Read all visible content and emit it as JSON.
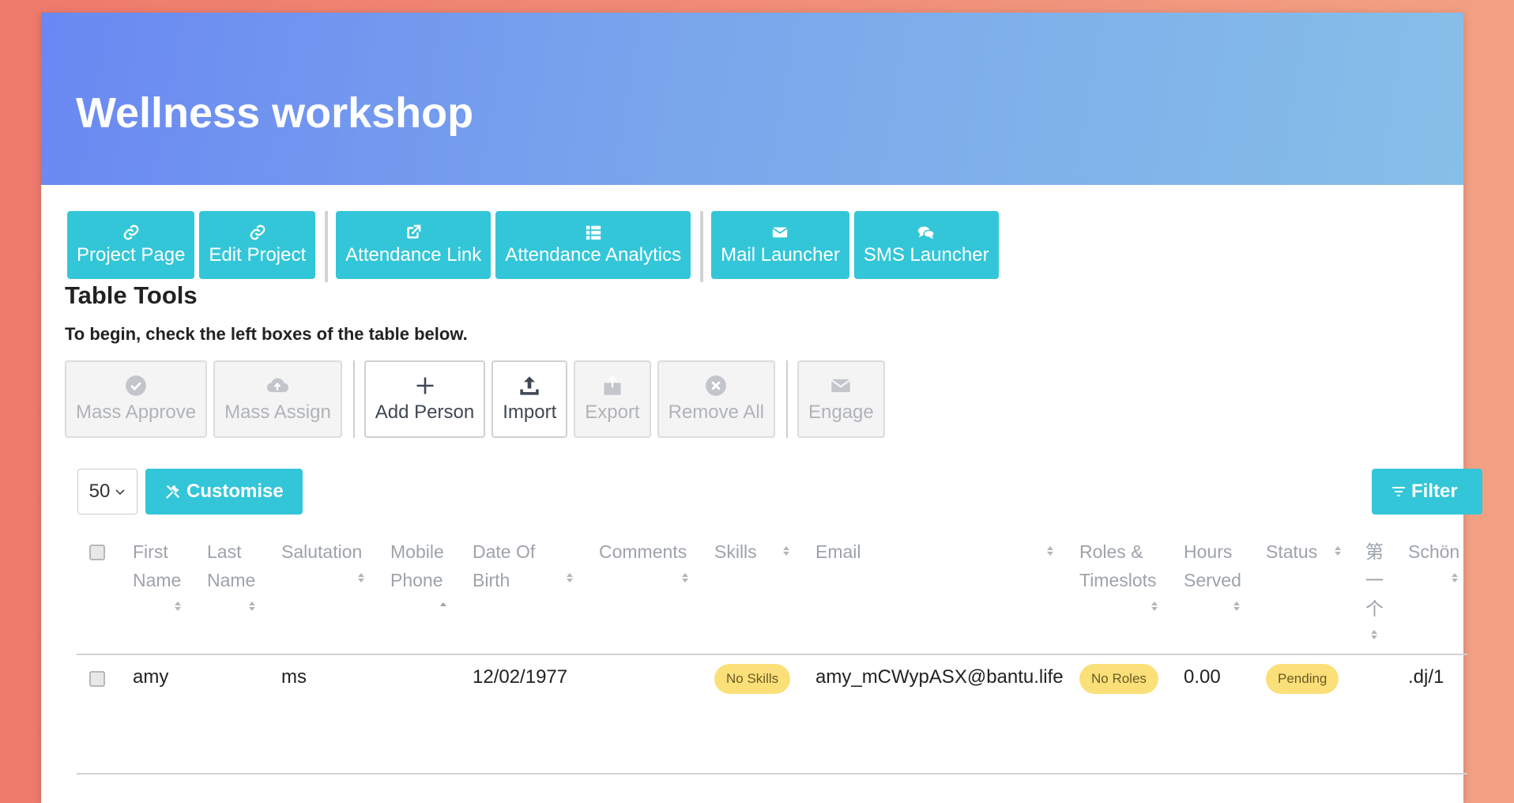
{
  "page": {
    "title": "Wellness workshop"
  },
  "actions": [
    {
      "label": "Project Page",
      "icon": "link-icon"
    },
    {
      "label": "Edit Project",
      "icon": "link-icon"
    },
    {
      "label": "Attendance Link",
      "icon": "external-link-icon"
    },
    {
      "label": "Attendance Analytics",
      "icon": "table-list-icon"
    },
    {
      "label": "Mail Launcher",
      "icon": "envelope-icon"
    },
    {
      "label": "SMS Launcher",
      "icon": "chat-icon"
    }
  ],
  "table_tools": {
    "title": "Table Tools",
    "instruction": "To begin, check the left boxes of the table below.",
    "buttons": [
      {
        "label": "Mass Approve",
        "icon": "check-circle-icon",
        "enabled": false
      },
      {
        "label": "Mass Assign",
        "icon": "cloud-upload-icon",
        "enabled": false
      },
      {
        "label": "Add Person",
        "icon": "plus-icon",
        "enabled": true
      },
      {
        "label": "Import",
        "icon": "upload-tray-icon",
        "enabled": true
      },
      {
        "label": "Export",
        "icon": "share-box-icon",
        "enabled": false
      },
      {
        "label": "Remove All",
        "icon": "x-circle-icon",
        "enabled": false
      },
      {
        "label": "Engage",
        "icon": "envelope-icon",
        "enabled": false
      }
    ]
  },
  "controls": {
    "page_size": "50",
    "customise_label": "Customise",
    "filter_label": "Filter"
  },
  "table": {
    "columns": [
      {
        "key": "first_name",
        "lines": [
          "First",
          "Name"
        ]
      },
      {
        "key": "last_name",
        "lines": [
          "Last",
          "Name"
        ]
      },
      {
        "key": "salutation",
        "lines": [
          "Salutation"
        ]
      },
      {
        "key": "mobile_phone",
        "lines": [
          "Mobile",
          "Phone"
        ]
      },
      {
        "key": "date_of_birth",
        "lines": [
          "Date Of",
          "Birth"
        ]
      },
      {
        "key": "comments",
        "lines": [
          "Comments"
        ]
      },
      {
        "key": "skills",
        "lines": [
          "Skills"
        ]
      },
      {
        "key": "email",
        "lines": [
          "Email"
        ]
      },
      {
        "key": "roles",
        "lines": [
          "Roles &",
          "Timeslots"
        ]
      },
      {
        "key": "hours",
        "lines": [
          "Hours",
          "Served"
        ]
      },
      {
        "key": "status",
        "lines": [
          "Status"
        ]
      },
      {
        "key": "cjk",
        "lines": [
          "第",
          "一",
          "个"
        ]
      },
      {
        "key": "schon",
        "lines": [
          "Schön"
        ]
      }
    ],
    "rows": [
      {
        "first_name": "amy",
        "last_name": "",
        "salutation": "ms",
        "mobile_phone": "",
        "date_of_birth": "12/02/1977",
        "comments": "",
        "skills": "No Skills",
        "email": "amy_mCWypASX@bantu.life",
        "roles": "No Roles",
        "hours": "0.00",
        "status": "Pending",
        "cjk": "",
        "schon": ".dj/1"
      }
    ]
  },
  "colors": {
    "accent": "#33c6d8",
    "badge": "#fbe07a",
    "banner_start": "#6a88f2",
    "banner_end": "#86bfe8"
  }
}
